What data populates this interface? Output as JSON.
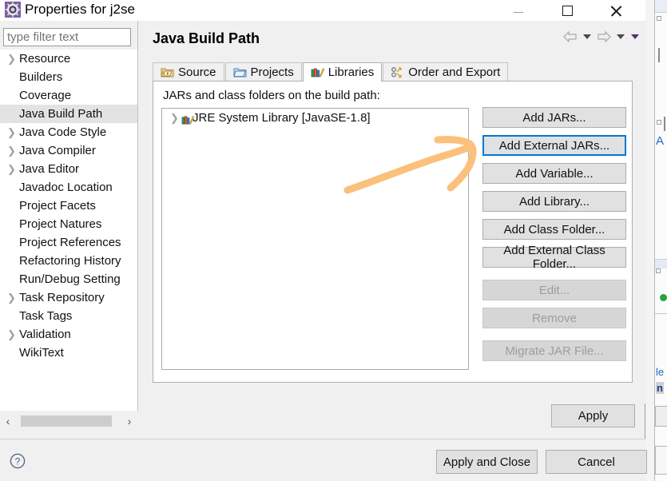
{
  "window": {
    "title": "Properties for j2se",
    "icon": "eclipse-properties-icon",
    "minimize_label": "Minimize",
    "maximize_label": "Maximize",
    "close_label": "Close"
  },
  "sidebar": {
    "filter": {
      "value": "",
      "placeholder": "type filter text"
    },
    "items": [
      {
        "label": "Resource",
        "expandable": true,
        "selected": false
      },
      {
        "label": "Builders",
        "expandable": false,
        "selected": false
      },
      {
        "label": "Coverage",
        "expandable": false,
        "selected": false
      },
      {
        "label": "Java Build Path",
        "expandable": false,
        "selected": true
      },
      {
        "label": "Java Code Style",
        "expandable": true,
        "selected": false
      },
      {
        "label": "Java Compiler",
        "expandable": true,
        "selected": false
      },
      {
        "label": "Java Editor",
        "expandable": true,
        "selected": false
      },
      {
        "label": "Javadoc Location",
        "expandable": false,
        "selected": false
      },
      {
        "label": "Project Facets",
        "expandable": false,
        "selected": false
      },
      {
        "label": "Project Natures",
        "expandable": false,
        "selected": false
      },
      {
        "label": "Project References",
        "expandable": false,
        "selected": false
      },
      {
        "label": "Refactoring History",
        "expandable": false,
        "selected": false
      },
      {
        "label": "Run/Debug Setting",
        "expandable": false,
        "selected": false
      },
      {
        "label": "Task Repository",
        "expandable": true,
        "selected": false
      },
      {
        "label": "Task Tags",
        "expandable": false,
        "selected": false
      },
      {
        "label": "Validation",
        "expandable": true,
        "selected": false
      },
      {
        "label": "WikiText",
        "expandable": false,
        "selected": false
      }
    ],
    "scrollbar": {
      "left_arrow": "‹",
      "right_arrow": "›"
    }
  },
  "main": {
    "page_title": "Java Build Path",
    "nav": {
      "back_icon": "back-arrow-icon",
      "back_menu_icon": "chevron-down-icon",
      "forward_icon": "forward-arrow-icon",
      "forward_menu_icon": "chevron-down-icon",
      "view_menu_icon": "chevron-down-icon"
    },
    "tabs": [
      {
        "label": "Source",
        "icon": "source-folder-icon",
        "active": false
      },
      {
        "label": "Projects",
        "icon": "projects-folder-icon",
        "active": false
      },
      {
        "label": "Libraries",
        "icon": "libraries-books-icon",
        "active": true
      },
      {
        "label": "Order and Export",
        "icon": "order-export-icon",
        "active": false
      }
    ],
    "panel_label": "JARs and class folders on the build path:",
    "list": [
      {
        "label": "JRE System Library [JavaSE-1.8]",
        "icon": "jre-library-icon",
        "expandable": true
      }
    ],
    "buttons": [
      {
        "label": "Add JARs...",
        "enabled": true,
        "focused": false,
        "gap_above": false
      },
      {
        "label": "Add External JARs...",
        "enabled": true,
        "focused": true,
        "gap_above": false
      },
      {
        "label": "Add Variable...",
        "enabled": true,
        "focused": false,
        "gap_above": false
      },
      {
        "label": "Add Library...",
        "enabled": true,
        "focused": false,
        "gap_above": false
      },
      {
        "label": "Add Class Folder...",
        "enabled": true,
        "focused": false,
        "gap_above": false
      },
      {
        "label": "Add External Class Folder...",
        "enabled": true,
        "focused": false,
        "gap_above": false
      },
      {
        "label": "Edit...",
        "enabled": false,
        "focused": false,
        "gap_above": true
      },
      {
        "label": "Remove",
        "enabled": false,
        "focused": false,
        "gap_above": false
      },
      {
        "label": "Migrate JAR File...",
        "enabled": false,
        "focused": false,
        "gap_above": true
      }
    ],
    "apply_label": "Apply"
  },
  "footer": {
    "help_icon": "help-question-icon",
    "apply_and_close_label": "Apply and Close",
    "cancel_label": "Cancel"
  },
  "annotation": {
    "type": "hand-drawn-arrow",
    "color": "#fbc07c",
    "points_to": "Add External JARs..."
  },
  "colors": {
    "dialog_background": "#f0f0f0",
    "panel_background": "#ffffff",
    "focus_border": "#0078d7",
    "selected_tree_item": "#e3e3e3",
    "disabled_text": "#9d9d9d",
    "annotation": "#fbc07c"
  }
}
